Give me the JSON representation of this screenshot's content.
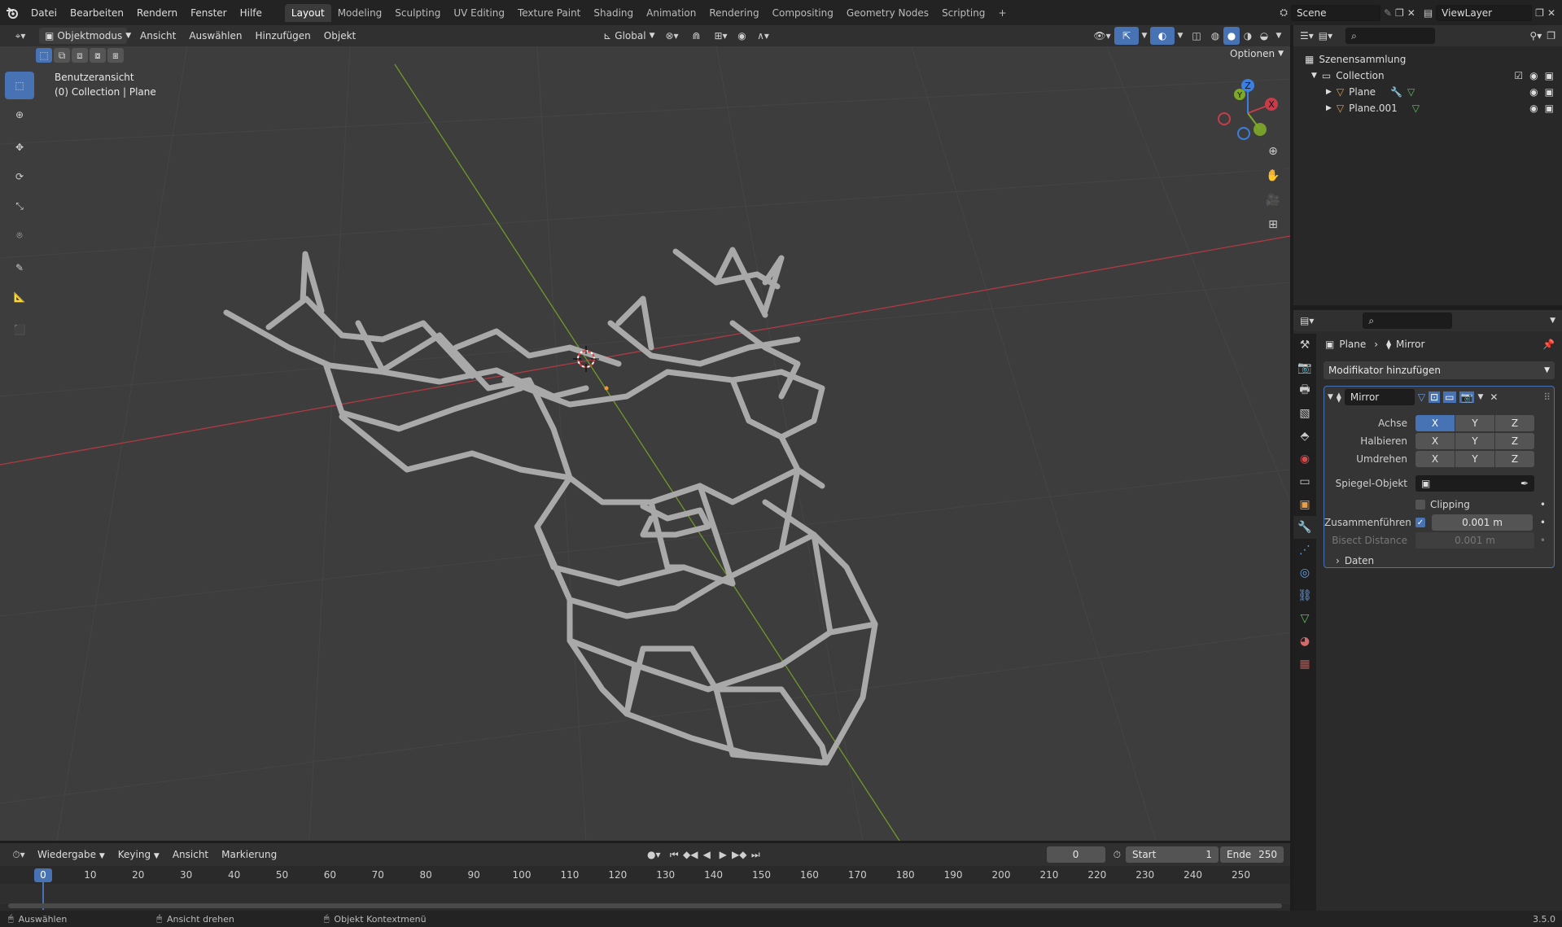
{
  "topbar": {
    "menus": [
      "Datei",
      "Bearbeiten",
      "Rendern",
      "Fenster",
      "Hilfe"
    ],
    "workspaces": [
      "Layout",
      "Modeling",
      "Sculpting",
      "UV Editing",
      "Texture Paint",
      "Shading",
      "Animation",
      "Rendering",
      "Compositing",
      "Geometry Nodes",
      "Scripting"
    ],
    "active_workspace": "Layout",
    "add_tab": "+",
    "scene": "Scene",
    "view_layer": "ViewLayer"
  },
  "viewport_header": {
    "mode": "Objektmodus",
    "menus": [
      "Ansicht",
      "Auswählen",
      "Hinzufügen",
      "Objekt"
    ],
    "transform_orientation": "Global",
    "options": "Optionen"
  },
  "viewport": {
    "view_name": "Benutzeransicht",
    "collection_info": "(0) Collection | Plane",
    "gizmo": {
      "x": "X",
      "y": "Y",
      "z": "Z"
    }
  },
  "outliner": {
    "root": "Szenensammlung",
    "collection": "Collection",
    "objects": [
      "Plane",
      "Plane.001"
    ]
  },
  "properties": {
    "breadcrumb_object": "Plane",
    "breadcrumb_modifier": "Mirror",
    "add_modifier": "Modifikator hinzufügen",
    "modifier_name": "Mirror",
    "axis_label": "Achse",
    "bisect_label": "Halbieren",
    "flip_label": "Umdrehen",
    "axis_buttons": [
      "X",
      "Y",
      "Z"
    ],
    "mirror_object_label": "Spiegel-Objekt",
    "clipping_label": "Clipping",
    "merge_label": "Zusammenführen",
    "merge_value": "0.001 m",
    "bisect_distance_label": "Bisect Distance",
    "bisect_distance_value": "0.001 m",
    "data_label": "Daten"
  },
  "timeline_header": {
    "menus": [
      "Wiedergabe",
      "Keying",
      "Ansicht",
      "Markierung"
    ],
    "current_frame": "0",
    "start_label": "Start",
    "start_value": "1",
    "end_label": "Ende",
    "end_value": "250"
  },
  "timeline": {
    "frames": [
      "0",
      "10",
      "20",
      "30",
      "40",
      "50",
      "60",
      "70",
      "80",
      "90",
      "100",
      "110",
      "120",
      "130",
      "140",
      "150",
      "160",
      "170",
      "180",
      "190",
      "200",
      "210",
      "220",
      "230",
      "240",
      "250"
    ]
  },
  "statusbar": {
    "select": "Auswählen",
    "rotate_view": "Ansicht drehen",
    "context_menu": "Objekt Kontextmenü",
    "version": "3.5.0"
  },
  "colors": {
    "accent": "#4772b3",
    "x_axis": "#c83c4a",
    "y_axis": "#7ea82a",
    "z_axis": "#3b7fe0",
    "mesh": "#a9a9a9"
  }
}
